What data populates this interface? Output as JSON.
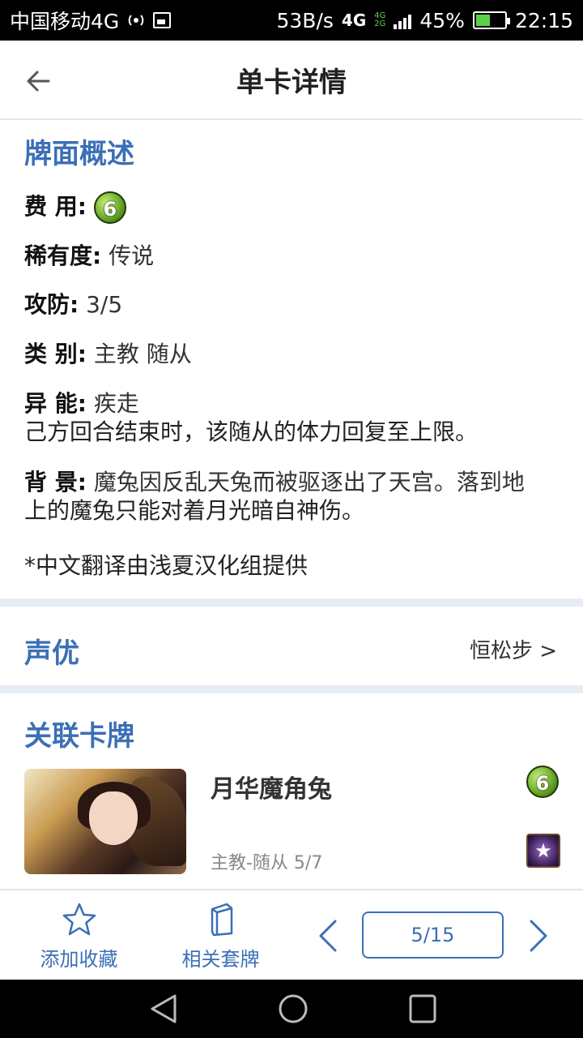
{
  "status_bar": {
    "carrier": "中国移动4G",
    "speed": "53B/s",
    "network": "4G",
    "network_small_top": "4G",
    "network_small_bottom": "2G",
    "battery": "45%",
    "time": "22:15"
  },
  "header": {
    "title": "单卡详情",
    "back_icon": "arrow-left-icon"
  },
  "overview": {
    "section_title": "牌面概述",
    "cost_label": "费 用:",
    "cost_value": "6",
    "rarity_label": "稀有度:",
    "rarity_value": "传说",
    "stats_label": "攻防:",
    "stats_value": "3/5",
    "type_label": "类 别:",
    "type_value": "主教 随从",
    "ability_label": "异 能:",
    "ability_value": "疾走",
    "ability_desc": "己方回合结束时，该随从的体力回复至上限。",
    "background_label": "背 景:",
    "background_value_line1": "魔兔因反乱天兔而被驱逐出了天宫。落到地",
    "background_value_line2": "上的魔兔只能对着月光暗自神伤。",
    "translation_note": "*中文翻译由浅夏汉化组提供"
  },
  "voice": {
    "section_title": "声优",
    "actor": "恒松步 >"
  },
  "related": {
    "section_title": "关联卡牌",
    "card_name": "月华魔角兔",
    "card_sub": "主教-随从  5/7",
    "card_cost": "6",
    "class_icon": "bishop-class-icon"
  },
  "toolbar": {
    "favorite_label": "添加收藏",
    "decks_label": "相关套牌",
    "page_indicator": "5/15"
  },
  "colors": {
    "accent": "#3b6fb6",
    "divider": "#e7edf5"
  }
}
